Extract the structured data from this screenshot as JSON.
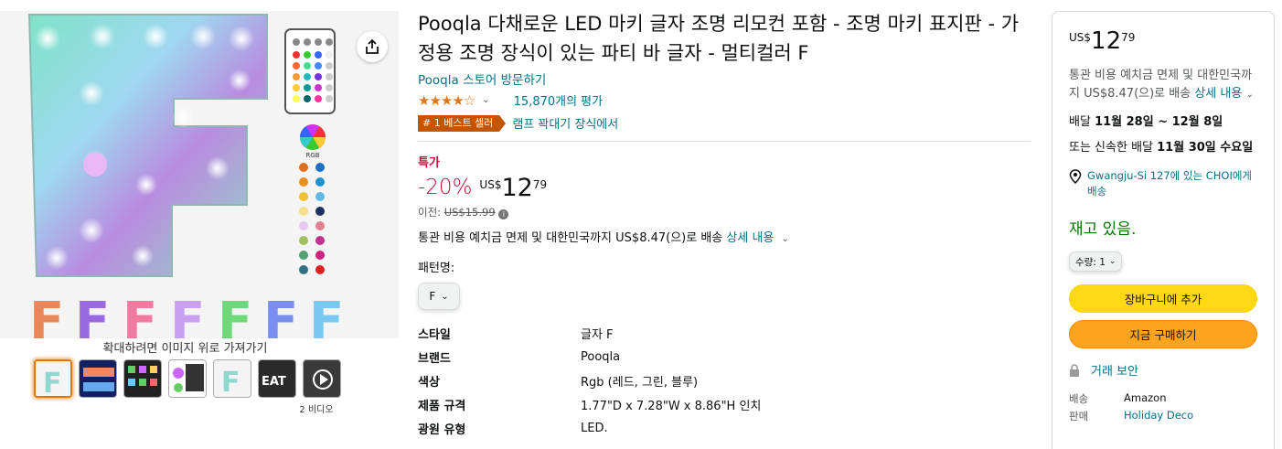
{
  "product": {
    "title": "Pooqla 다채로운 LED 마키 글자 조명 리모컨 포함 - 조명 마키 표지판 - 가정용 조명 장식이 있는 파티 바 글자 - 멀티컬러 F",
    "store_link": "Pooqla 스토어 방문하기",
    "rating_value": 4.5,
    "rating_count": "15,870개의 평가",
    "bestseller_badge": "# 1 베스트 셀러",
    "bestseller_category": "램프 꽉대기 장식에서"
  },
  "gallery": {
    "zoom_hint": "확대하려면 이미지 위로 가져가기",
    "video_label": "2 비디오",
    "remote_label": "RGB"
  },
  "pricing": {
    "deal_label": "특가",
    "discount": "-20%",
    "currency": "US$",
    "whole": "12",
    "fraction": "79",
    "list_price_label": "이전:",
    "list_price": "US$15.99",
    "shipping_text": "통관 비용 예치금 면제 및 대한민국까지 US$8.47(으)로 배송",
    "shipping_link": "상세 내용"
  },
  "variant": {
    "pattern_label": "패턴명:",
    "selected": "F"
  },
  "specs": [
    {
      "k": "스타일",
      "v": "글자 F"
    },
    {
      "k": "브랜드",
      "v": "Pooqla"
    },
    {
      "k": "색상",
      "v": "Rgb (레드, 그린, 블루)"
    },
    {
      "k": "제품 규격",
      "v": "1.77\"D x 7.28\"W x 8.86\"H 인치"
    },
    {
      "k": "광원 유형",
      "v": "LED."
    }
  ],
  "buybox": {
    "currency": "US$",
    "whole": "12",
    "fraction": "79",
    "shipping_text": "통관 비용 예치금 면제 및 대한민국까지 US$8.47(으)로 배송",
    "shipping_link": "상세 내용",
    "delivery_prefix": "배달",
    "delivery_date": "11월 28일 ~ 12월 8일",
    "fast_prefix": "또는 신속한 배달",
    "fast_date": "11월 30일 수요일",
    "location": "Gwangju-Si 127에 있는 CHOI에게 배송",
    "stock": "재고 있음.",
    "qty_label": "수량: 1",
    "cart_button": "장바구니에 추가",
    "buy_button": "지금 구매하기",
    "secure": "거래 보안",
    "ship_from_k": "배송",
    "ship_from_v": "Amazon",
    "sold_by_k": "판매",
    "sold_by_v": "Holiday Deco"
  },
  "colors": {
    "link": "#007185",
    "deal": "#cc0c39",
    "badge": "#c45500",
    "cart": "#ffd814",
    "buy": "#ffa41c",
    "stock": "#007600"
  }
}
